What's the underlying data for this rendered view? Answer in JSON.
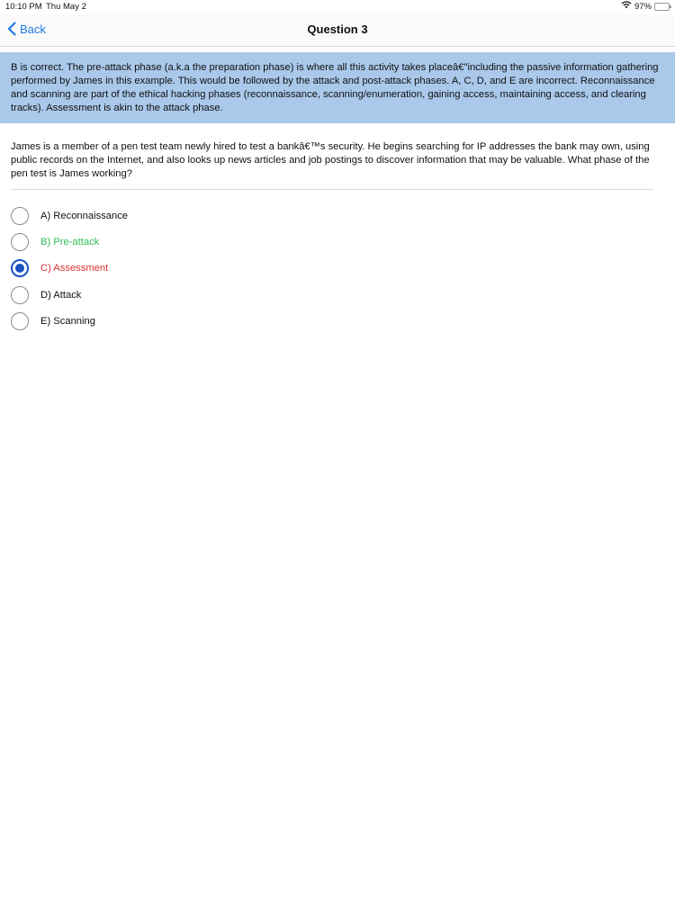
{
  "status_bar": {
    "time": "10:10 PM",
    "date": "Thu May 2",
    "battery": "97%",
    "icons": [
      "wifi-icon",
      "battery-icon"
    ]
  },
  "nav": {
    "back_label": "Back",
    "title": "Question 3"
  },
  "explanation": "B is correct. The pre-attack phase (a.k.a the preparation phase) is where all this activity takes placeâ€\"including the passive information gathering performed by James in this example. This would be followed by the attack and post-attack phases. A, C, D, and E are incorrect. Reconnaissance and scanning are part of the ethical hacking phases (reconnaissance, scanning/enumeration, gaining access, maintaining access, and clearing tracks). Assessment is akin to the attack phase.",
  "question": "James is a member of a pen test team newly hired to test a bankâ€™s security. He begins searching for IP addresses the bank may own, using public records on the Internet, and also looks up news articles and job postings to discover information that may be valuable. What phase of the pen test is James working?",
  "options": [
    {
      "label": "A) Reconnaissance",
      "state": "neutral",
      "selected": false
    },
    {
      "label": "B) Pre-attack",
      "state": "correct",
      "selected": false
    },
    {
      "label": "C) Assessment",
      "state": "wrong",
      "selected": true
    },
    {
      "label": "D) Attack",
      "state": "neutral",
      "selected": false
    },
    {
      "label": "E) Scanning",
      "state": "neutral",
      "selected": false
    }
  ],
  "colors": {
    "accent": "#1f7ae0",
    "explanation_bg": "#a9c8ea",
    "correct": "#2fbf56",
    "wrong": "#e03131",
    "selected_radio": "#1a52c4"
  }
}
